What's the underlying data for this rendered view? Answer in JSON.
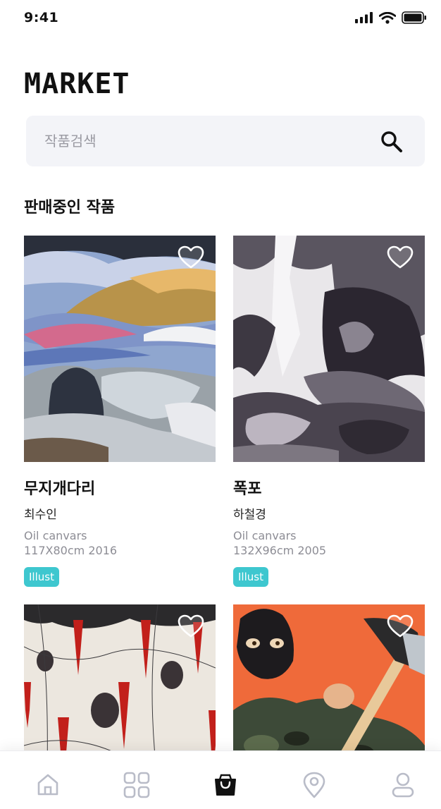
{
  "status_bar": {
    "time": "9:41"
  },
  "header": {
    "title": "MARKET"
  },
  "search": {
    "placeholder": "작품검색"
  },
  "section": {
    "title": "판매중인 작품"
  },
  "artworks": [
    {
      "title": "무지개다리",
      "artist": "최수인",
      "material": "Oil canvars",
      "size": "117X80cm 2016",
      "tag": "Illust"
    },
    {
      "title": "폭포",
      "artist": "하철경",
      "material": "Oil canvars",
      "size": "132X96cm 2005",
      "tag": "Illust"
    },
    {
      "title": "",
      "artist": "",
      "material": "",
      "size": "",
      "tag": ""
    },
    {
      "title": "",
      "artist": "",
      "material": "",
      "size": "",
      "tag": ""
    }
  ],
  "bottom_nav": {
    "items": [
      {
        "icon": "home-icon",
        "active": false
      },
      {
        "icon": "grid-icon",
        "active": false
      },
      {
        "icon": "shopping-bag-icon",
        "active": true
      },
      {
        "icon": "location-pin-icon",
        "active": false
      },
      {
        "icon": "user-icon",
        "active": false
      }
    ]
  },
  "colors": {
    "accent": "#3ec7cf",
    "search_bg": "#f3f4f8",
    "muted_text": "#8d8d95",
    "icon_inactive": "#b9bcc8"
  }
}
